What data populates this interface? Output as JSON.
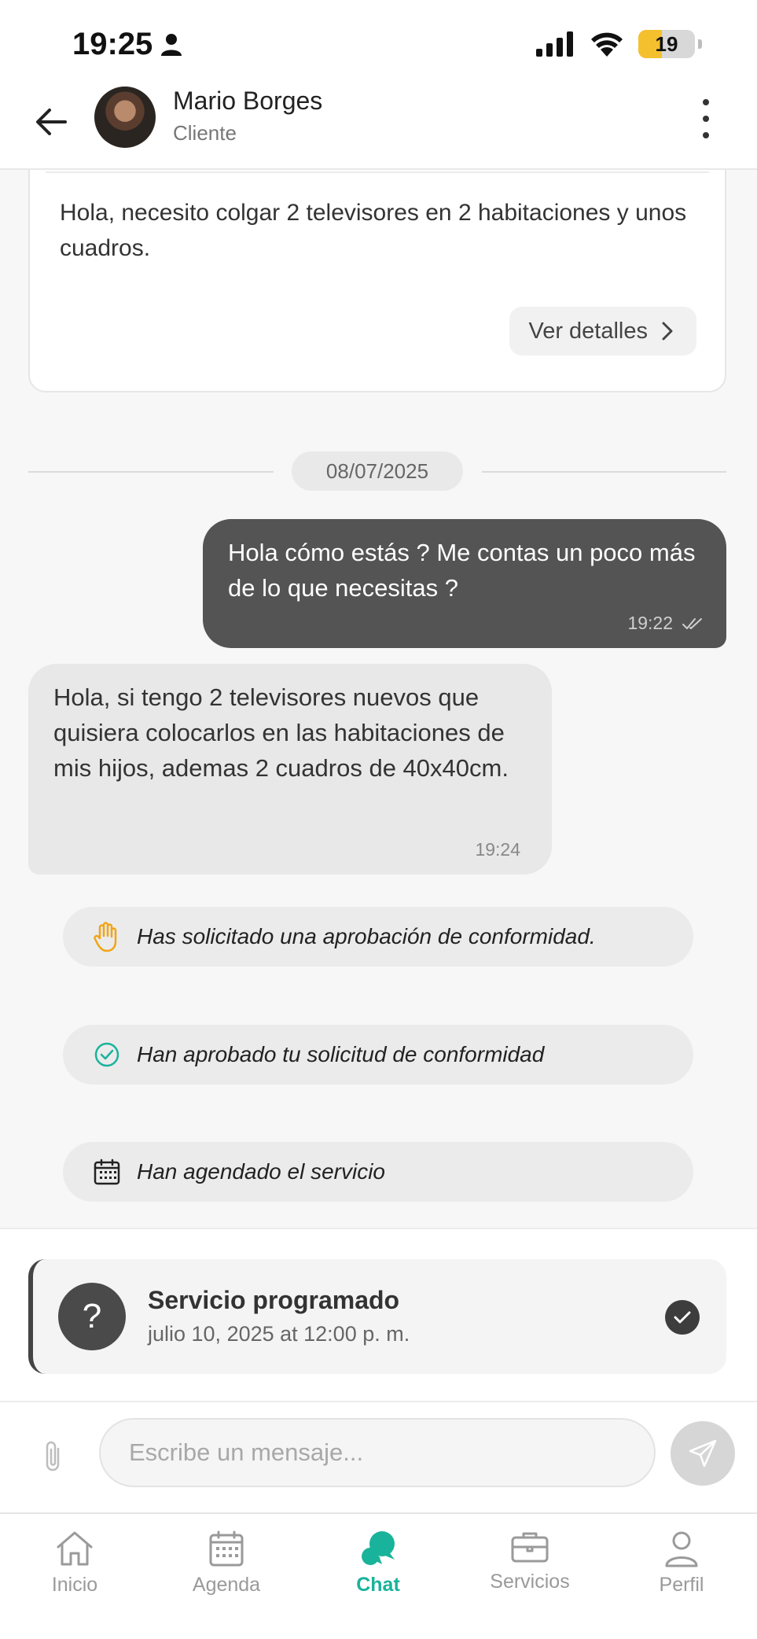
{
  "status_bar": {
    "time": "19:25",
    "battery_level": "19",
    "battery_fraction": 0.19
  },
  "header": {
    "contact_name": "Mario Borges",
    "contact_role": "Cliente"
  },
  "request_card": {
    "text": "Hola, necesito colgar 2 televisores en 2 habitaciones y unos cuadros.",
    "details_label": "Ver detalles"
  },
  "date_separator": "08/07/2025",
  "messages": [
    {
      "direction": "outgoing",
      "text": "Hola cómo estás ? Me contas un poco más de lo que necesitas ?",
      "time": "19:22",
      "read_icon": "double-check-icon"
    },
    {
      "direction": "incoming",
      "text": "Hola, si tengo 2 televisores nuevos que quisiera colocarlos en las habitaciones de mis hijos, ademas 2 cuadros de 40x40cm.",
      "time": "19:24"
    }
  ],
  "system_events": [
    {
      "icon": "hand-icon",
      "text": "Has solicitado una aprobación de conformidad."
    },
    {
      "icon": "check-circle-icon",
      "text": "Han aprobado tu solicitud de conformidad"
    },
    {
      "icon": "calendar-icon",
      "text": "Han agendado el servicio"
    }
  ],
  "scheduled_service": {
    "title": "Servicio programado",
    "date": "julio 10, 2025 at 12:00 p. m.",
    "status_icon": "check-icon"
  },
  "composer": {
    "placeholder": "Escribe un mensaje..."
  },
  "tabbar": {
    "tabs": [
      {
        "label": "Inicio",
        "icon": "home-icon",
        "active": false
      },
      {
        "label": "Agenda",
        "icon": "calendar-icon",
        "active": false
      },
      {
        "label": "Chat",
        "icon": "chat-icon",
        "active": true
      },
      {
        "label": "Servicios",
        "icon": "briefcase-icon",
        "active": false
      },
      {
        "label": "Perfil",
        "icon": "person-icon",
        "active": false
      }
    ]
  },
  "colors": {
    "accent": "#19b39b",
    "outgoing_bubble": "#545454",
    "incoming_bubble": "#e8e8e8"
  }
}
